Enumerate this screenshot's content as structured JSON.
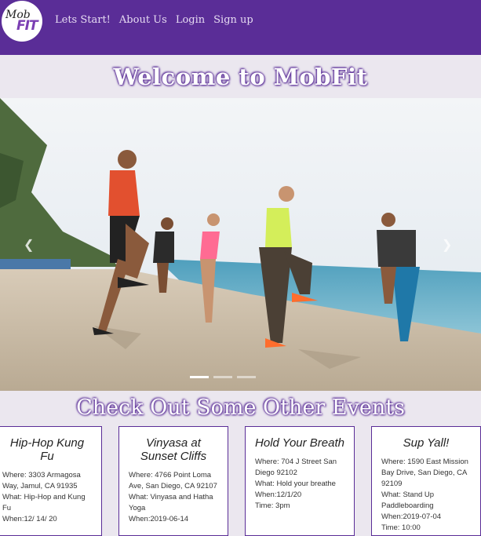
{
  "logo": {
    "top": "Mob",
    "bottom": "FIT"
  },
  "nav": {
    "links": [
      "Lets Start!",
      "About Us",
      "Login",
      "Sign up"
    ]
  },
  "welcome": {
    "title": "Welcome to MobFit"
  },
  "carousel": {
    "indicator_count": 3,
    "active_index": 0
  },
  "events": {
    "title": "Check Out Some Other Events",
    "cards": [
      {
        "title": "Hip-Hop Kung Fu",
        "lines": [
          "Where: 3303 Armagosa Way, Jamul, CA 91935",
          "What: Hip-Hop and Kung Fu",
          "When:12/ 14/ 20"
        ]
      },
      {
        "title": "Vinyasa at Sunset Cliffs",
        "lines": [
          "Where: 4766 Point Loma Ave, San Diego, CA 92107",
          "What: Vinyasa and Hatha Yoga",
          "When:2019-06-14"
        ]
      },
      {
        "title": "Hold Your Breath",
        "lines": [
          "Where: 704 J Street San Diego 92102",
          "What: Hold your breathe",
          "When:12/1/20",
          "Time: 3pm"
        ]
      },
      {
        "title": "Sup Yall!",
        "lines": [
          "Where: 1590 East Mission Bay Drive, San Diego, CA 92109",
          "What: Stand Up Paddleboarding",
          "When:2019-07-04",
          "Time: 10:00"
        ]
      }
    ]
  },
  "colors": {
    "nav_bg": "#5a2d97",
    "page_bg": "#ebe7ef",
    "accent": "#7b3fb3"
  }
}
